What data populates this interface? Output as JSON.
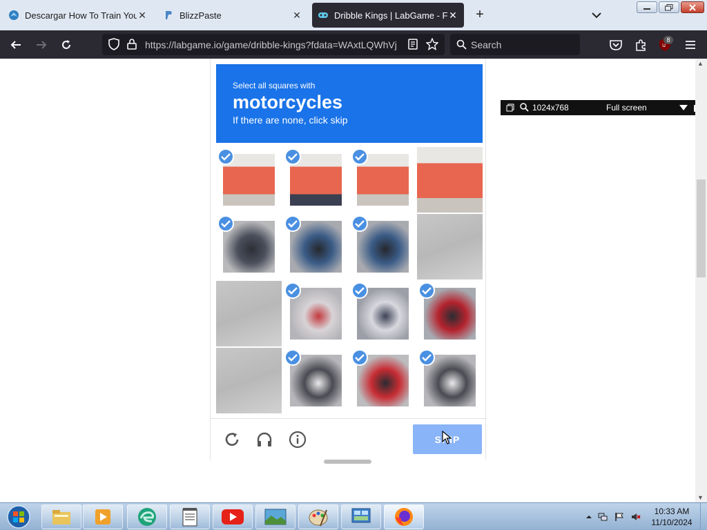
{
  "tabs": [
    {
      "title": "Descargar How To Train Your Dr",
      "favicon": "dragon-favicon",
      "active": false
    },
    {
      "title": "BlizzPaste",
      "favicon": "blizzpaste-favicon",
      "active": false
    },
    {
      "title": "Dribble Kings | LabGame - Free",
      "favicon": "gamepad-favicon",
      "active": true
    }
  ],
  "navbar": {
    "url": "https://labgame.io/game/dribble-kings?fdata=WAxtLQWhVj",
    "search_placeholder": "Search",
    "extension_badge": "8"
  },
  "extension_bar": {
    "resolution": "1024x768",
    "mode": "Full screen"
  },
  "captcha": {
    "instruction": "Select all squares with",
    "target": "motorcycles",
    "hint": "If there are none, click skip",
    "skip_label": "SKIP",
    "header_color": "#1a73e8",
    "check_color": "#4a90e2",
    "tiles": [
      {
        "selected": true,
        "content": "traffic barriers"
      },
      {
        "selected": true,
        "content": "rider behind barriers"
      },
      {
        "selected": true,
        "content": "traffic barriers"
      },
      {
        "selected": false,
        "content": "traffic barriers"
      },
      {
        "selected": true,
        "content": "motorcycle front wheel"
      },
      {
        "selected": true,
        "content": "motorcycle with rider"
      },
      {
        "selected": true,
        "content": "motorcycle with rider"
      },
      {
        "selected": false,
        "content": "road"
      },
      {
        "selected": false,
        "content": "road"
      },
      {
        "selected": true,
        "content": "motorcycle rear"
      },
      {
        "selected": true,
        "content": "rider jacket"
      },
      {
        "selected": true,
        "content": "rider helmet"
      },
      {
        "selected": false,
        "content": "road"
      },
      {
        "selected": true,
        "content": "motorcycle wheel"
      },
      {
        "selected": true,
        "content": "motorcycle body"
      },
      {
        "selected": true,
        "content": "motorcycle wheel"
      }
    ]
  },
  "taskbar": {
    "apps": [
      "file-explorer",
      "media-player",
      "edge-browser",
      "notepad",
      "youtube",
      "photo-viewer",
      "paint",
      "control-panel",
      "firefox"
    ]
  },
  "clock": {
    "time": "10:33 AM",
    "date": "11/10/2024"
  }
}
